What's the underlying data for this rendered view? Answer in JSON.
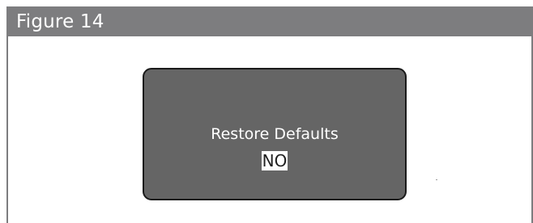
{
  "figure": {
    "caption": "Figure 14"
  },
  "screen": {
    "title": "Restore Defaults",
    "selected_value": "NO"
  },
  "colors": {
    "caption_bar": "#7d7d7f",
    "screen_background": "#656565",
    "screen_border": "#1a1a1a",
    "highlight": "#ffffff"
  }
}
